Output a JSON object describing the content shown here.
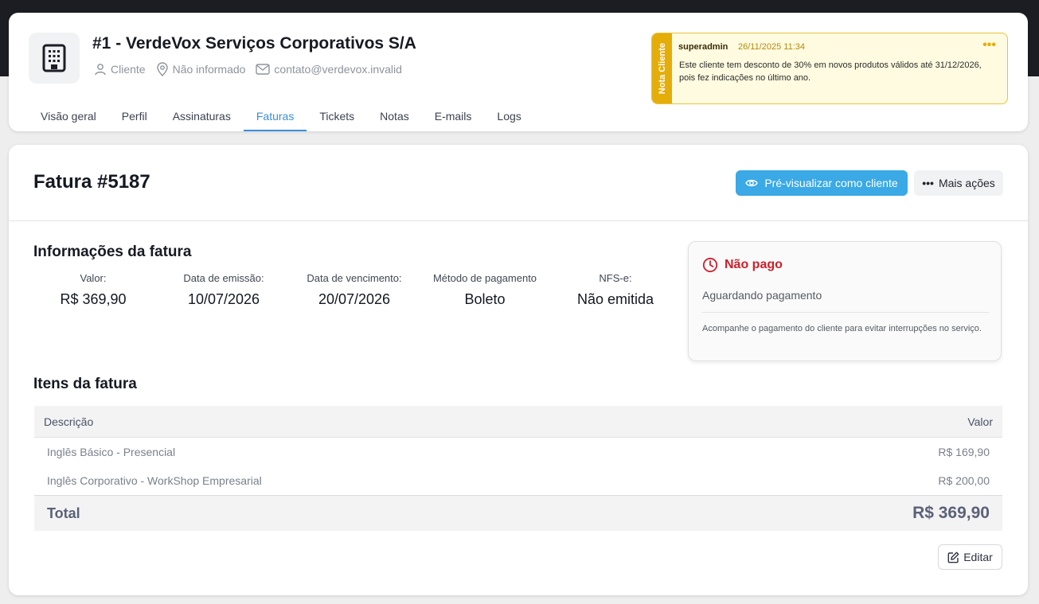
{
  "header": {
    "title": "#1 - VerdeVox Serviços Corporativos S/A",
    "type": "Cliente",
    "location": "Não informado",
    "email": "contato@verdevox.invalid"
  },
  "tabs": [
    {
      "label": "Visão geral",
      "active": false
    },
    {
      "label": "Perfil",
      "active": false
    },
    {
      "label": "Assinaturas",
      "active": false
    },
    {
      "label": "Faturas",
      "active": true
    },
    {
      "label": "Tickets",
      "active": false
    },
    {
      "label": "Notas",
      "active": false
    },
    {
      "label": "E-mails",
      "active": false
    },
    {
      "label": "Logs",
      "active": false
    }
  ],
  "note": {
    "badge": "Nota Cliente",
    "author": "superadmin",
    "date": "26/11/2025 11:34",
    "menu": "•••",
    "text": "Este cliente tem desconto de 30% em novos produtos válidos até 31/12/2026, pois fez indicações no último ano."
  },
  "invoice": {
    "title": "Fatura #5187",
    "preview_label": "Pré-visualizar como cliente",
    "more_label": "Mais ações",
    "more_dots": "•••",
    "edit_label": "Editar"
  },
  "info": {
    "title": "Informações da fatura",
    "fields": [
      {
        "label": "Valor:",
        "value": "R$ 369,90"
      },
      {
        "label": "Data de emissão:",
        "value": "10/07/2026"
      },
      {
        "label": "Data de vencimento:",
        "value": "20/07/2026"
      },
      {
        "label": "Método de pagamento",
        "value": "Boleto"
      },
      {
        "label": "NFS-e:",
        "value": "Não emitida"
      }
    ]
  },
  "status": {
    "title": "Não pago",
    "subtitle": "Aguardando pagamento",
    "note": "Acompanhe o pagamento do cliente para evitar interrupções no serviço.",
    "color": "#cf1f2a"
  },
  "items": {
    "title": "Itens da fatura",
    "columns": [
      "Descrição",
      "Valor"
    ],
    "rows": [
      {
        "description": "Inglês Básico - Presencial",
        "value": "R$ 169,90"
      },
      {
        "description": "Inglês Corporativo - WorkShop Empresarial",
        "value": "R$ 200,00"
      }
    ],
    "total_label": "Total",
    "total_value": "R$ 369,90"
  },
  "colors": {
    "accent": "#3b8fd6",
    "primary_button": "#3aa9e6",
    "note_strip": "#e5ad0a"
  }
}
